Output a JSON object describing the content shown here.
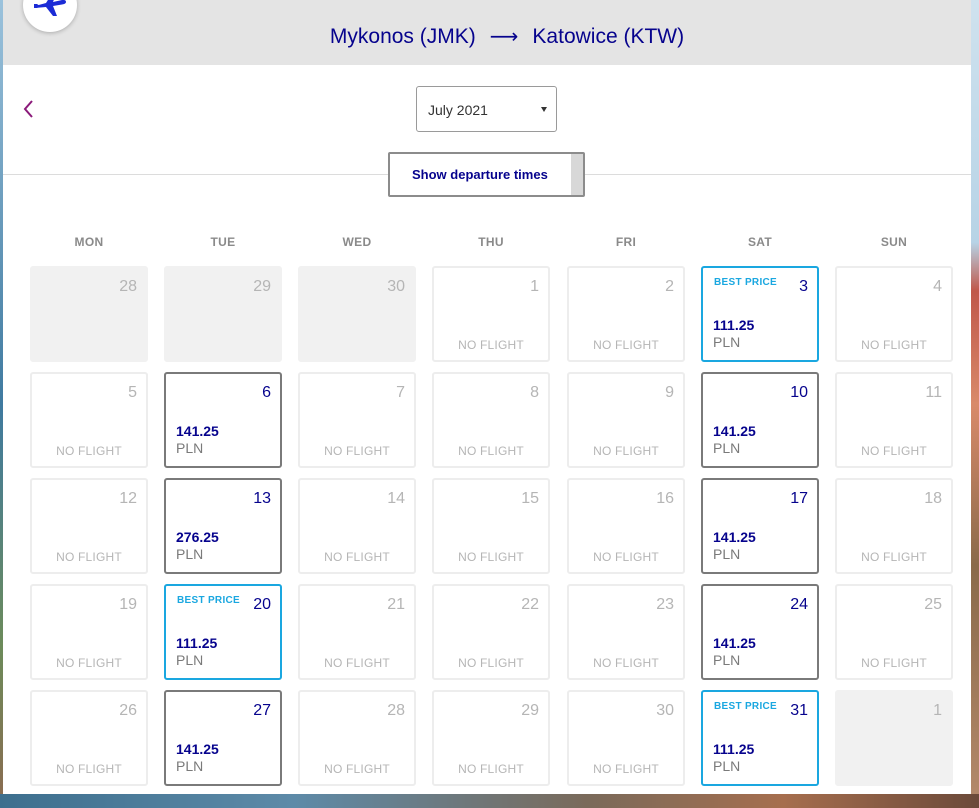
{
  "header": {
    "origin": "Mykonos (JMK)",
    "destination": "Katowice (KTW)",
    "arrow": "⟶"
  },
  "month_select": {
    "value": "July 2021"
  },
  "show_times_label": "Show departure times",
  "weekdays": [
    "MON",
    "TUE",
    "WED",
    "THU",
    "FRI",
    "SAT",
    "SUN"
  ],
  "labels": {
    "no_flight": "NO FLIGHT",
    "best_price": "BEST PRICE",
    "currency": "PLN"
  },
  "weeks": [
    [
      {
        "day": "28",
        "state": "out"
      },
      {
        "day": "29",
        "state": "out"
      },
      {
        "day": "30",
        "state": "out"
      },
      {
        "day": "1",
        "state": "none"
      },
      {
        "day": "2",
        "state": "none"
      },
      {
        "day": "3",
        "state": "best",
        "price": "111.25"
      },
      {
        "day": "4",
        "state": "none"
      }
    ],
    [
      {
        "day": "5",
        "state": "none"
      },
      {
        "day": "6",
        "state": "priced",
        "price": "141.25"
      },
      {
        "day": "7",
        "state": "none"
      },
      {
        "day": "8",
        "state": "none"
      },
      {
        "day": "9",
        "state": "none"
      },
      {
        "day": "10",
        "state": "priced",
        "price": "141.25"
      },
      {
        "day": "11",
        "state": "none"
      }
    ],
    [
      {
        "day": "12",
        "state": "none"
      },
      {
        "day": "13",
        "state": "priced",
        "price": "276.25"
      },
      {
        "day": "14",
        "state": "none"
      },
      {
        "day": "15",
        "state": "none"
      },
      {
        "day": "16",
        "state": "none"
      },
      {
        "day": "17",
        "state": "priced",
        "price": "141.25"
      },
      {
        "day": "18",
        "state": "none"
      }
    ],
    [
      {
        "day": "19",
        "state": "none"
      },
      {
        "day": "20",
        "state": "best",
        "price": "111.25"
      },
      {
        "day": "21",
        "state": "none"
      },
      {
        "day": "22",
        "state": "none"
      },
      {
        "day": "23",
        "state": "none"
      },
      {
        "day": "24",
        "state": "priced",
        "price": "141.25"
      },
      {
        "day": "25",
        "state": "none"
      }
    ],
    [
      {
        "day": "26",
        "state": "none"
      },
      {
        "day": "27",
        "state": "priced",
        "price": "141.25"
      },
      {
        "day": "28",
        "state": "none"
      },
      {
        "day": "29",
        "state": "none"
      },
      {
        "day": "30",
        "state": "none"
      },
      {
        "day": "31",
        "state": "best",
        "price": "111.25"
      },
      {
        "day": "1",
        "state": "out"
      }
    ]
  ],
  "colors": {
    "brand_navy": "#06038d",
    "best_price_blue": "#1aa7e0",
    "back_chevron": "#8b1a7a"
  },
  "icons": {
    "logo": "airplane-icon",
    "back": "chevron-left-icon",
    "dropdown": "caret-down-icon"
  }
}
